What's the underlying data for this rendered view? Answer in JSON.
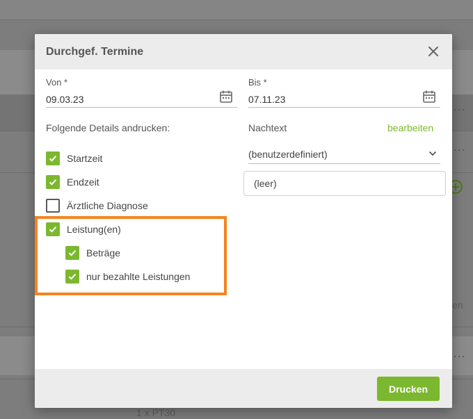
{
  "background": {
    "peek_text_bottom": "1 x PT30",
    "peek_text_right": "en"
  },
  "dialog": {
    "title": "Durchgef. Termine",
    "from": {
      "label": "Von *",
      "value": "09.03.23"
    },
    "to": {
      "label": "Bis *",
      "value": "07.11.23"
    },
    "details_label": "Folgende Details andrucken:",
    "checkboxes": [
      {
        "label": "Startzeit",
        "checked": true
      },
      {
        "label": "Endzeit",
        "checked": true
      },
      {
        "label": "Ärztliche Diagnose",
        "checked": false
      },
      {
        "label": "Leistung(en)",
        "checked": true
      },
      {
        "label": "Beträge",
        "checked": true,
        "indented": true
      },
      {
        "label": "nur bezahlte Leistungen",
        "checked": true,
        "indented": true
      }
    ],
    "footer_text": {
      "label": "Nachtext",
      "edit_link": "bearbeiten"
    },
    "template_select": {
      "value": "(benutzerdefiniert)"
    },
    "text_box": {
      "value": "(leer)"
    },
    "print_button": "Drucken"
  },
  "colors": {
    "accent": "#7cb82f",
    "highlight": "#f5841f"
  },
  "icons": [
    "close-icon",
    "calendar-icon",
    "check-icon",
    "chevron-down-icon"
  ]
}
